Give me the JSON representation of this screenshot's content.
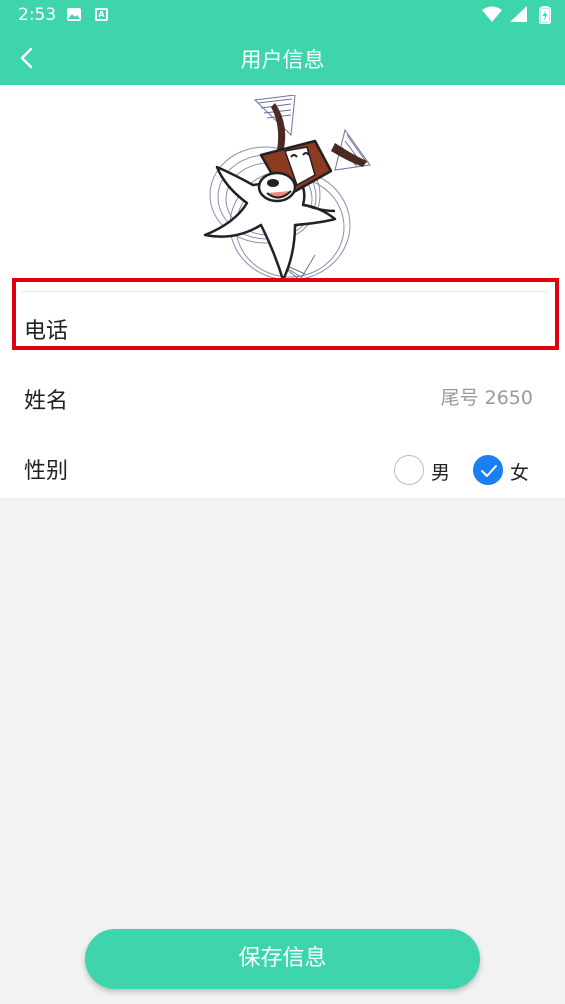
{
  "status_bar": {
    "time": "2:53",
    "notification_icons": [
      "image-icon",
      "a-icon"
    ],
    "system_icons": [
      "wifi-icon",
      "signal-icon",
      "battery-charging-icon"
    ]
  },
  "app_bar": {
    "title": "用户信息",
    "back_icon": "chevron-left-icon",
    "background_color": "#3ed5ad"
  },
  "profile": {
    "avatar_icon": "cartoon-dog-avatar",
    "phone_label": "电话",
    "phone_value": "",
    "name_label": "姓名",
    "name_value": "",
    "name_placeholder": "尾号 2650",
    "gender_label": "性别",
    "gender_options": [
      {
        "label": "男",
        "checked": false
      },
      {
        "label": "女",
        "checked": true
      }
    ]
  },
  "actions": {
    "save_label": "保存信息"
  },
  "colors": {
    "accent": "#3ed5ad",
    "highlight": "#e00010",
    "radio_checked": "#1a7ff0"
  }
}
